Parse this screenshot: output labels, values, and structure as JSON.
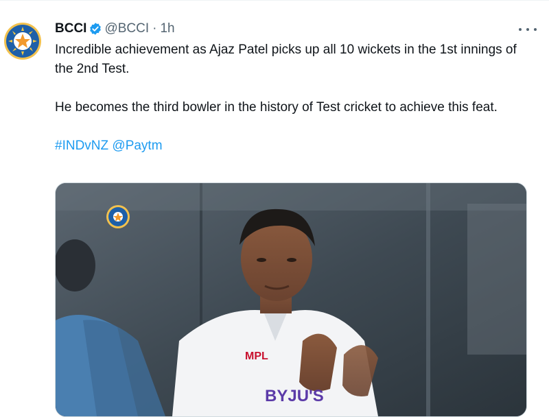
{
  "tweet": {
    "author_name": "BCCI",
    "verified": true,
    "handle": "@BCCI",
    "separator": "·",
    "time": "1h",
    "more_icon": "ellipsis-icon",
    "text_lines": [
      "Incredible achievement as Ajaz Patel picks up all 10 wickets in the 1st innings of the 2nd Test.",
      "He becomes the third bowler in the history of Test cricket to achieve this feat."
    ],
    "hashtag": "#INDvNZ",
    "mention": "@Paytm",
    "media": {
      "type": "video-still",
      "shirt_logos": [
        "MPL",
        "BYJU'S"
      ]
    }
  },
  "colors": {
    "link": "#1d9bf0",
    "secondary_text": "#536471",
    "primary_text": "#0f1419",
    "verified_badge": "#1d9bf0"
  }
}
